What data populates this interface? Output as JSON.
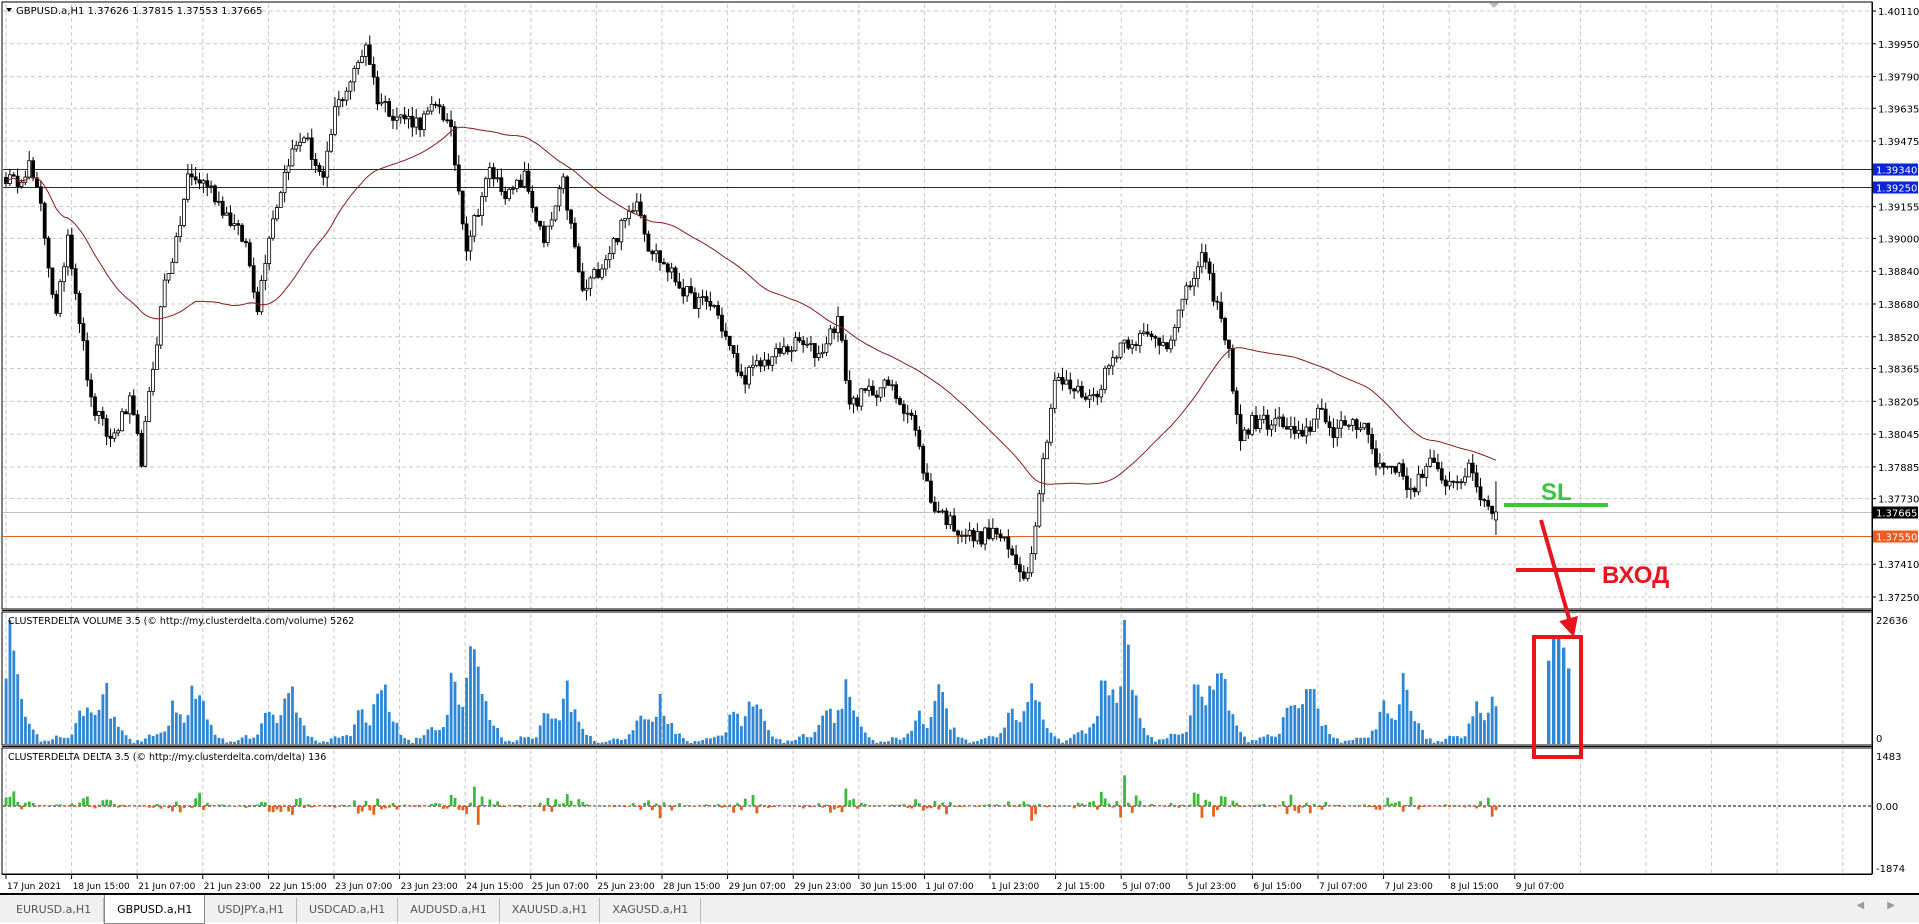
{
  "main_chart": {
    "title": "GBPUSD.a,H1  1.37626 1.37815 1.37553 1.37665",
    "symbol": "GBPUSD.a,H1",
    "ohlc": {
      "open": 1.37626,
      "high": 1.37815,
      "low": 1.37553,
      "close": 1.37665
    },
    "price_axis_labels": [
      "1.40110",
      "1.39950",
      "1.39790",
      "1.39635",
      "1.39475",
      "1.39155",
      "1.39000",
      "1.38840",
      "1.38680",
      "1.38520",
      "1.38365",
      "1.38205",
      "1.38045",
      "1.37885",
      "1.37730",
      "1.37410",
      "1.37250"
    ],
    "price_range": [
      1.3725,
      1.4011
    ],
    "horizontal_lines": [
      {
        "price": 1.3934,
        "label": "1.39340",
        "color": "#1a1aa6",
        "label_bg": "#0a24d6"
      },
      {
        "price": 1.3925,
        "label": "1.39250",
        "color": "#1a1aa6",
        "label_bg": "#0a24d6"
      },
      {
        "price": 1.37665,
        "label": "1.37665",
        "color": "#c0c0c0",
        "label_bg": "#000000"
      },
      {
        "price": 1.3755,
        "label": "1.37550",
        "color": "#e0642a",
        "label_bg": "#f05a1e"
      }
    ],
    "close_keypoints": [
      [
        0,
        1.393
      ],
      [
        2,
        1.39268
      ],
      [
        6,
        1.39358
      ],
      [
        9,
        1.39149
      ],
      [
        13,
        1.38611
      ],
      [
        16,
        1.39029
      ],
      [
        19,
        1.38611
      ],
      [
        22,
        1.38193
      ],
      [
        27,
        1.38014
      ],
      [
        32,
        1.38193
      ],
      [
        35,
        1.37924
      ],
      [
        38,
        1.38372
      ],
      [
        41,
        1.3879
      ],
      [
        44,
        1.38969
      ],
      [
        47,
        1.39298
      ],
      [
        52,
        1.39268
      ],
      [
        57,
        1.39119
      ],
      [
        62,
        1.38969
      ],
      [
        65,
        1.38671
      ],
      [
        68,
        1.39029
      ],
      [
        73,
        1.39388
      ],
      [
        77,
        1.39507
      ],
      [
        82,
        1.39268
      ],
      [
        85,
        1.39626
      ],
      [
        90,
        1.39806
      ],
      [
        93,
        1.39955
      ],
      [
        96,
        1.39686
      ],
      [
        101,
        1.39597
      ],
      [
        107,
        1.39567
      ],
      [
        112,
        1.39656
      ],
      [
        115,
        1.39507
      ],
      [
        119,
        1.38969
      ],
      [
        122,
        1.39149
      ],
      [
        125,
        1.39328
      ],
      [
        130,
        1.39208
      ],
      [
        134,
        1.39298
      ],
      [
        139,
        1.38969
      ],
      [
        144,
        1.39268
      ],
      [
        149,
        1.3873
      ],
      [
        155,
        1.3891
      ],
      [
        160,
        1.39089
      ],
      [
        163,
        1.39208
      ],
      [
        166,
        1.38969
      ],
      [
        171,
        1.3885
      ],
      [
        177,
        1.38701
      ],
      [
        183,
        1.38671
      ],
      [
        190,
        1.38312
      ],
      [
        194,
        1.38372
      ],
      [
        199,
        1.38432
      ],
      [
        205,
        1.38492
      ],
      [
        210,
        1.38432
      ],
      [
        215,
        1.38611
      ],
      [
        218,
        1.38193
      ],
      [
        223,
        1.38253
      ],
      [
        228,
        1.38283
      ],
      [
        234,
        1.38133
      ],
      [
        239,
        1.37715
      ],
      [
        245,
        1.37596
      ],
      [
        250,
        1.37536
      ],
      [
        256,
        1.37566
      ],
      [
        261,
        1.37416
      ],
      [
        264,
        1.37357
      ],
      [
        267,
        1.37775
      ],
      [
        271,
        1.38312
      ],
      [
        277,
        1.38253
      ],
      [
        281,
        1.38223
      ],
      [
        288,
        1.38492
      ],
      [
        294,
        1.38521
      ],
      [
        300,
        1.38492
      ],
      [
        305,
        1.3873
      ],
      [
        309,
        1.3891
      ],
      [
        313,
        1.38671
      ],
      [
        316,
        1.38432
      ],
      [
        319,
        1.38014
      ],
      [
        322,
        1.38103
      ],
      [
        329,
        1.38103
      ],
      [
        335,
        1.38014
      ],
      [
        340,
        1.38193
      ],
      [
        343,
        1.38014
      ],
      [
        346,
        1.38103
      ],
      [
        351,
        1.38103
      ],
      [
        354,
        1.37894
      ],
      [
        359,
        1.37894
      ],
      [
        363,
        1.37775
      ],
      [
        368,
        1.37894
      ],
      [
        373,
        1.37805
      ],
      [
        378,
        1.37864
      ],
      [
        382,
        1.37715
      ],
      [
        385,
        1.37665
      ]
    ],
    "ma_period": 50,
    "ma_color": "#8b1a1a"
  },
  "annotations": {
    "sl_label": "SL",
    "sl_color": "#3cc43c",
    "entry_label": "ВХОД",
    "entry_color": "#e8141e"
  },
  "volume_panel": {
    "title": "CLUSTERDELTA VOLUME 3.5 (© http://my.clusterdelta.com/volume) 5262",
    "axis_max_label": "22636",
    "axis_min_label": "0",
    "max": 22636,
    "color": "#2e86d6",
    "hour_profile": [
      0.05,
      0.05,
      0.08,
      0.12,
      0.14,
      0.12,
      0.14,
      0.18,
      0.35,
      0.55,
      0.65,
      0.5,
      0.45,
      0.55,
      0.8,
      1.0,
      0.85,
      0.6,
      0.4,
      0.3,
      0.2,
      0.12,
      0.08,
      0.02
    ],
    "day_scales": [
      0.95,
      0.55,
      0.6,
      0.5,
      0.55,
      1.0,
      0.5,
      0.4,
      0.45,
      0.55,
      0.45,
      0.55,
      0.95,
      0.8,
      0.6,
      0.55,
      0.5
    ],
    "highlight_values": [
      15200,
      19600,
      19900,
      17600,
      13800
    ]
  },
  "delta_panel": {
    "title": "CLUSTERDELTA DELTA 3.5 (© http://my.clusterdelta.com/delta) 136",
    "axis_max_label": "1483",
    "axis_zero_label": "0.00",
    "axis_min_label": "-1874",
    "max": 1483,
    "min": -1874,
    "positive_color": "#3cb83c",
    "negative_color": "#e8601e"
  },
  "time_axis_labels": [
    "17 Jun 2021",
    "18 Jun 15:00",
    "21 Jun 07:00",
    "21 Jun 23:00",
    "22 Jun 15:00",
    "23 Jun 07:00",
    "23 Jun 23:00",
    "24 Jun 15:00",
    "25 Jun 07:00",
    "25 Jun 23:00",
    "28 Jun 15:00",
    "29 Jun 07:00",
    "29 Jun 23:00",
    "30 Jun 15:00",
    "1 Jul 07:00",
    "1 Jul 23:00",
    "2 Jul 15:00",
    "5 Jul 07:00",
    "5 Jul 23:00",
    "6 Jul 15:00",
    "7 Jul 07:00",
    "7 Jul 23:00",
    "8 Jul 15:00",
    "9 Jul 07:00"
  ],
  "tabs": [
    {
      "label": "EURUSD.a,H1",
      "active": false
    },
    {
      "label": "GBPUSD.a,H1",
      "active": true
    },
    {
      "label": "USDJPY.a,H1",
      "active": false
    },
    {
      "label": "USDCAD.a,H1",
      "active": false
    },
    {
      "label": "AUDUSD.a,H1",
      "active": false
    },
    {
      "label": "XAUUSD.a,H1",
      "active": false
    },
    {
      "label": "XAGUSD.a,H1",
      "active": false
    }
  ],
  "scroll_arrows": "◀ ▶"
}
